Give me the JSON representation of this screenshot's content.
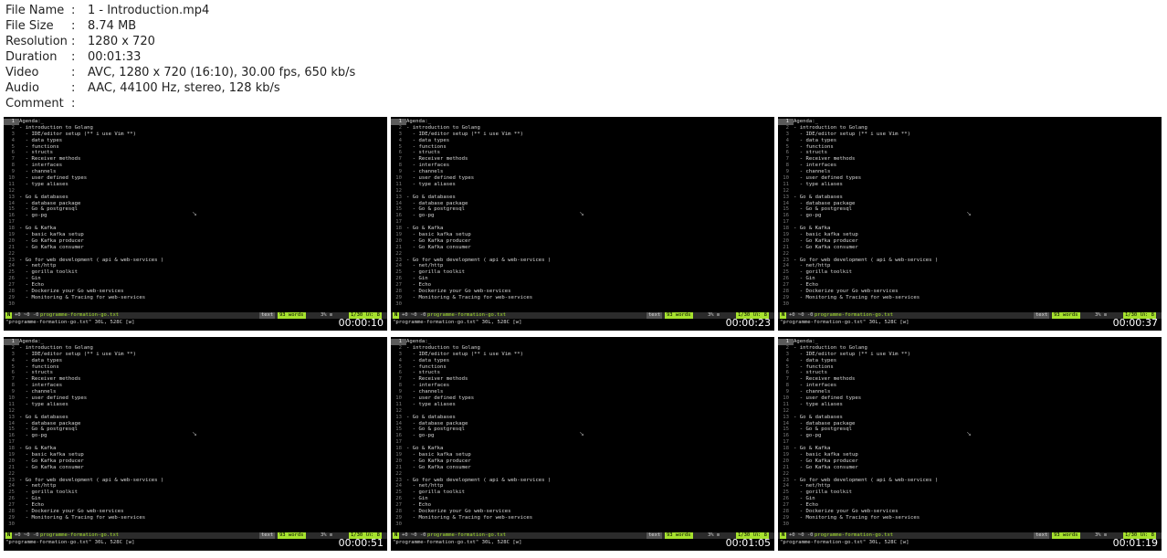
{
  "metadata": [
    {
      "label": "File Name",
      "value": "1 - Introduction.mp4"
    },
    {
      "label": "File Size",
      "value": "8.74 MB"
    },
    {
      "label": "Resolution",
      "value": "1280 x 720"
    },
    {
      "label": "Duration",
      "value": "00:01:33"
    },
    {
      "label": "Video",
      "value": "AVC, 1280 x 720 (16:10), 30.00 fps, 650 kb/s"
    },
    {
      "label": "Audio",
      "value": "AAC, 44100 Hz, stereo, 128 kb/s"
    },
    {
      "label": "Comment",
      "value": ""
    }
  ],
  "vim": {
    "lines": [
      "Agenda:_",
      "- introduction to Golang",
      "  - IDE/editor setup (** i use Vim **)",
      "  - data types",
      "  - functions",
      "  - structs",
      "  - Receiver methods",
      "  - interfaces",
      "  - channels",
      "  - user defined types",
      "  - type aliases",
      "",
      "- Go & databases",
      "  - database package",
      "  - Go & postgresql",
      "  - go-pg",
      "",
      "- Go & Kafka",
      "  - basic kafka setup",
      "  - Go Kafka producer",
      "  - Go Kafka consumer",
      "",
      "- Go for web development ( api & web-services )",
      "  - net/http",
      "  - gorilla toolkit",
      "  - Gin",
      "  - Echo",
      "  - Dockerize your Go web-services",
      "  - Monitoring & Tracing for web-services",
      ""
    ],
    "status": {
      "mode": "N",
      "git": "+0 ~0 -0",
      "filename": "programme-formation-go.txt",
      "filetype": "text",
      "words": "93 words",
      "percent": "3% ≡",
      "position": "1/30 ㏑: 8"
    },
    "cmdline": "\"programme-formation-go.txt\" 30L, 528C [w]"
  },
  "thumbnails": [
    {
      "timestamp": "00:00:10"
    },
    {
      "timestamp": "00:00:23"
    },
    {
      "timestamp": "00:00:37"
    },
    {
      "timestamp": "00:00:51"
    },
    {
      "timestamp": "00:01:05"
    },
    {
      "timestamp": "00:01:19"
    }
  ]
}
